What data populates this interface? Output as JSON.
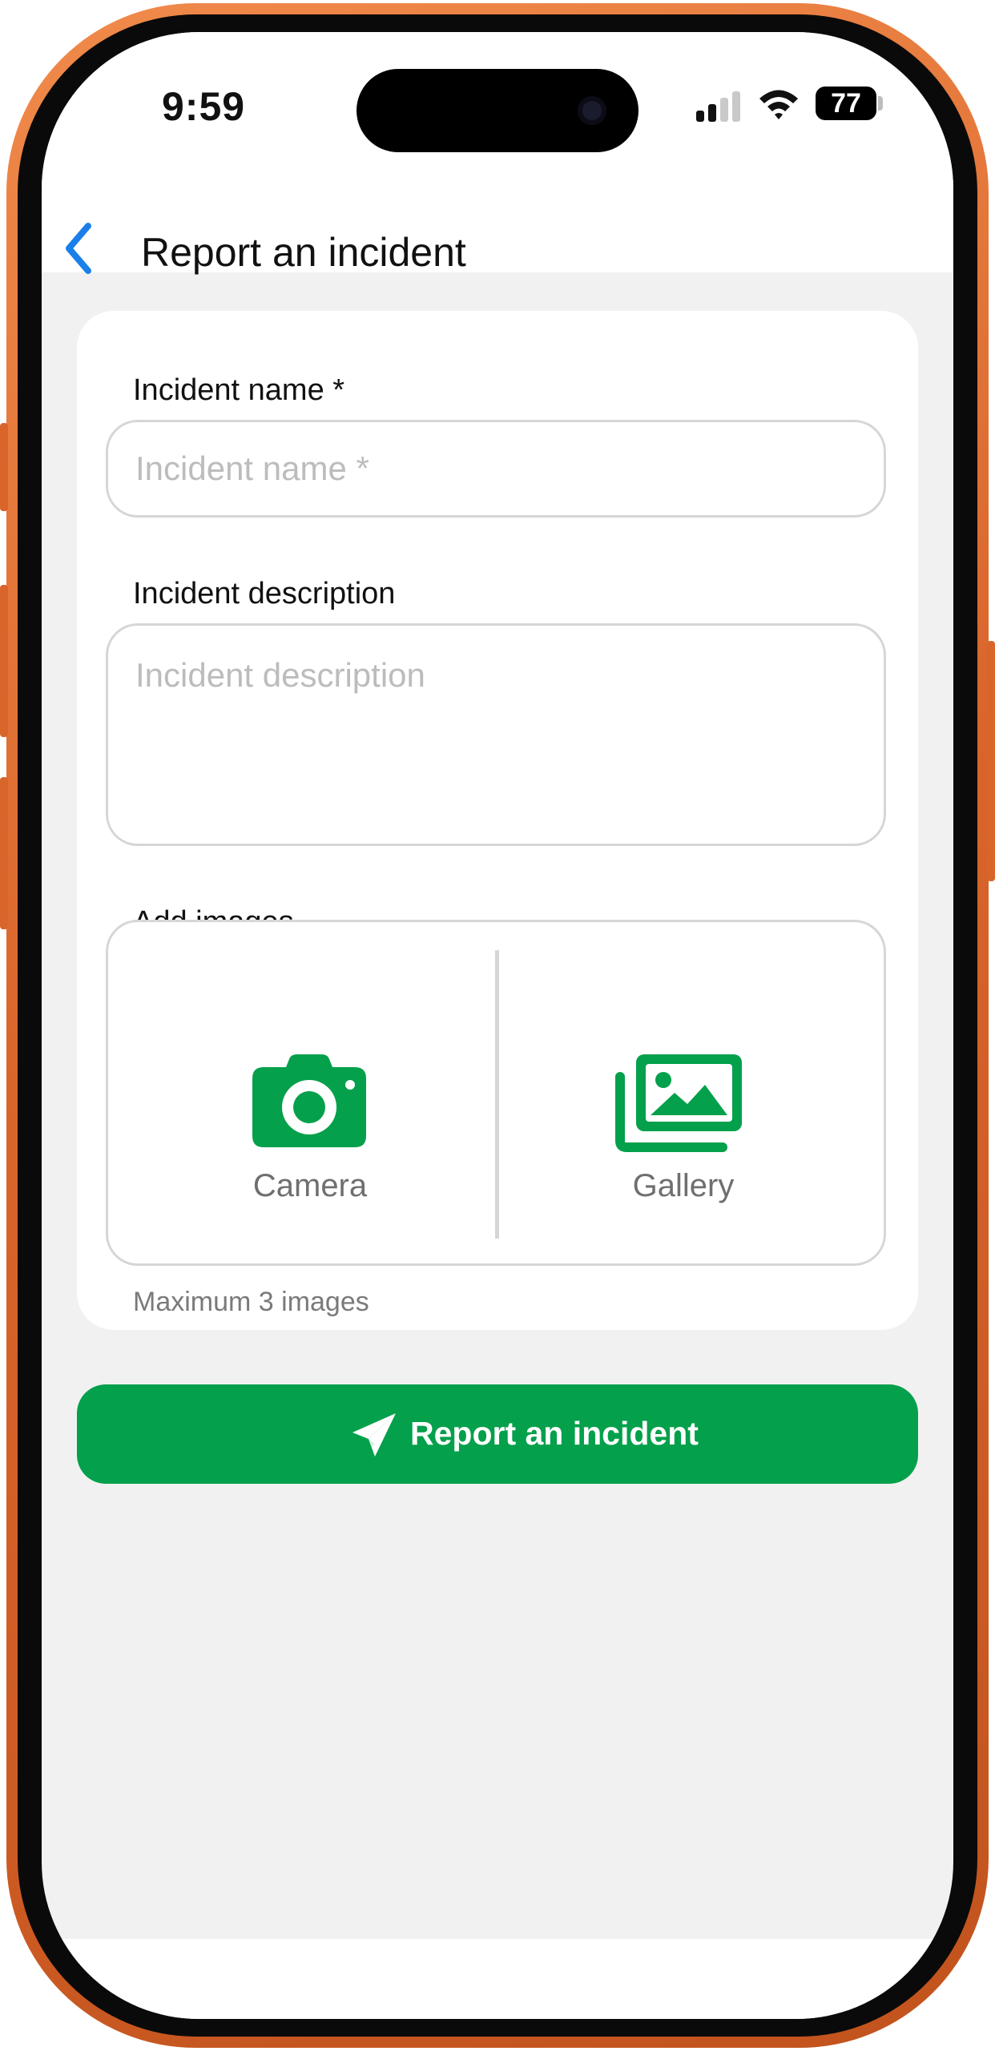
{
  "status_bar": {
    "time": "9:59",
    "battery": "77"
  },
  "header": {
    "title": "Report an incident"
  },
  "form": {
    "name": {
      "label": "Incident name *",
      "placeholder": "Incident name *",
      "value": ""
    },
    "description": {
      "label": "Incident description",
      "placeholder": "Incident description",
      "value": ""
    },
    "images": {
      "label": "Add images",
      "camera_label": "Camera",
      "gallery_label": "Gallery",
      "hint": "Maximum 3 images"
    }
  },
  "submit": {
    "label": "Report an incident",
    "icon": "paper-plane-icon"
  },
  "colors": {
    "accent_green": "#04a04b",
    "back_blue": "#1a7fe8",
    "frame_orange": "#d9652b"
  }
}
